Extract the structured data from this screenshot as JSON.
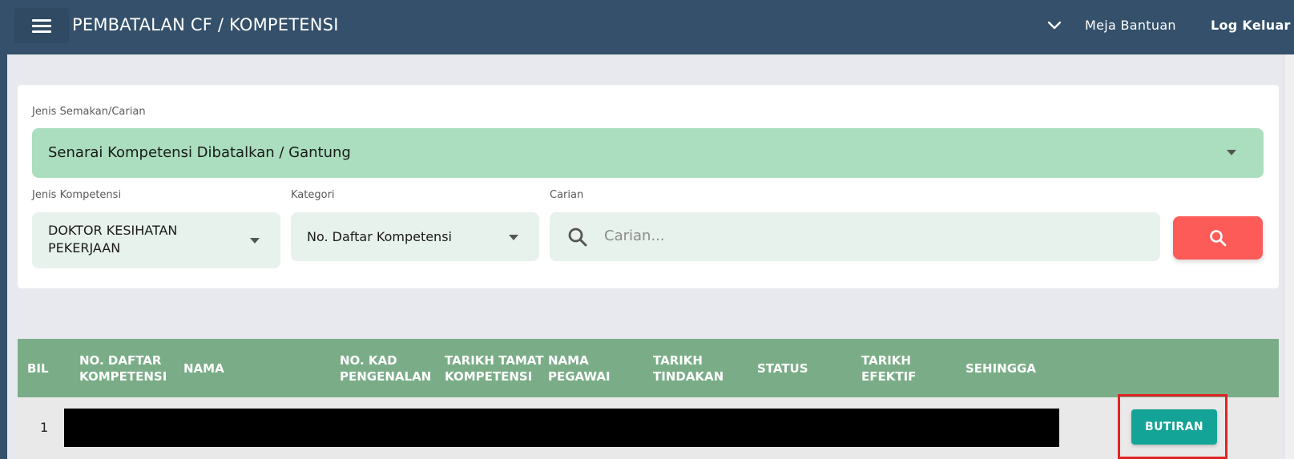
{
  "header": {
    "title": "PEMBATALAN CF / KOMPETENSI",
    "help_label": "Meja Bantuan",
    "logout_label": "Log Keluar"
  },
  "filters": {
    "jenis_semakan": {
      "label": "Jenis Semakan/Carian",
      "value": "Senarai Kompetensi Dibatalkan / Gantung"
    },
    "jenis_kompetensi": {
      "label": "Jenis Kompetensi",
      "value_line1": "DOKTOR KESIHATAN",
      "value_line2": "PEKERJAAN"
    },
    "kategori": {
      "label": "Kategori",
      "value": "No. Daftar Kompetensi"
    },
    "carian": {
      "label": "Carian",
      "placeholder": "Carian..."
    }
  },
  "table": {
    "headers": [
      [
        "BIL"
      ],
      [
        "NO. DAFTAR",
        "KOMPETENSI"
      ],
      [
        "NAMA"
      ],
      [
        "NO. KAD",
        "PENGENALAN"
      ],
      [
        "TARIKH TAMAT",
        "KOMPETENSI"
      ],
      [
        "NAMA",
        "PEGAWAI"
      ],
      [
        "TARIKH",
        "TINDAKAN"
      ],
      [
        "STATUS"
      ],
      [
        "TARIKH",
        "EFEKTIF"
      ],
      [
        "SEHINGGA"
      ]
    ],
    "rows": [
      {
        "bil": "1",
        "action_label": "BUTIRAN"
      }
    ]
  },
  "colors": {
    "topbar": "#34506a",
    "select_green": "#aadebe",
    "table_header": "#7aad87",
    "search_button": "#fc5b58",
    "detail_button": "#14a497",
    "highlight": "#e02424"
  }
}
